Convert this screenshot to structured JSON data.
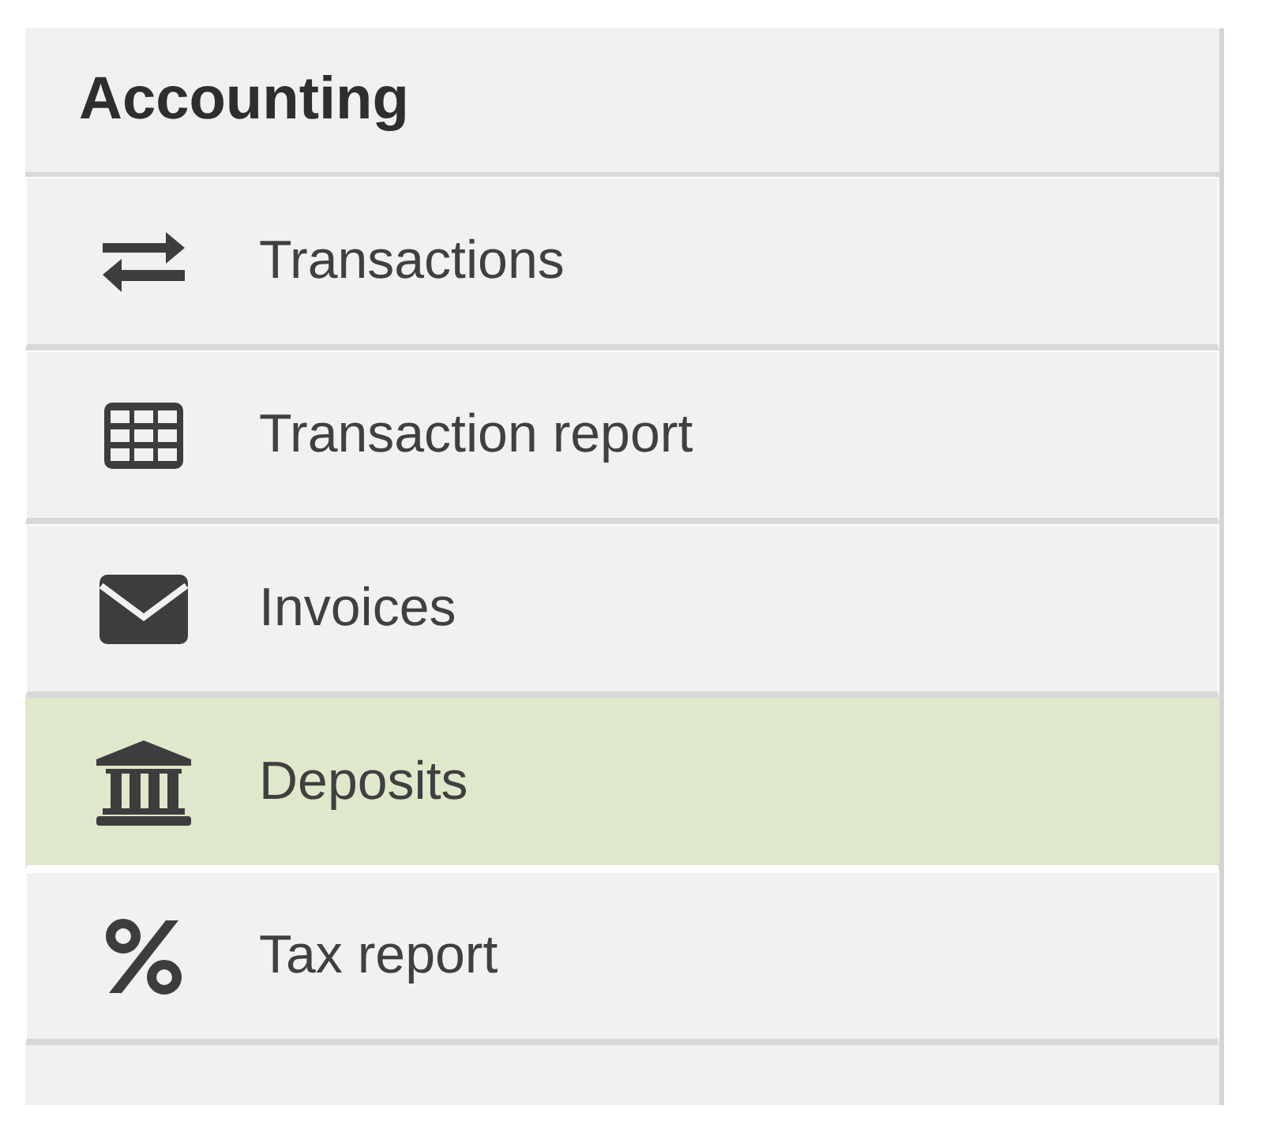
{
  "panel": {
    "title": "Accounting"
  },
  "items": [
    {
      "label": "Transactions",
      "kind": "arrows",
      "selected": false
    },
    {
      "label": "Transaction report",
      "kind": "table",
      "selected": false
    },
    {
      "label": "Invoices",
      "kind": "envelope",
      "selected": false
    },
    {
      "label": "Deposits",
      "kind": "bank",
      "selected": true
    },
    {
      "label": "Tax report",
      "kind": "percent",
      "selected": false
    }
  ]
}
